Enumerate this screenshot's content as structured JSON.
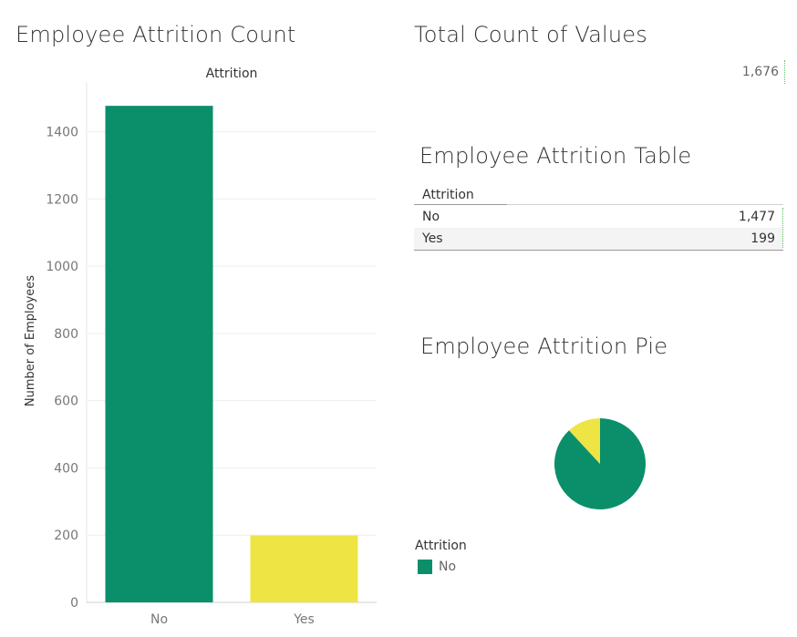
{
  "bar_title": "Employee Attrition Count",
  "total_title": "Total Count of Values",
  "total_value": "1,676",
  "table_title": "Employee Attrition Table",
  "pie_title": "Employee Attrition Pie",
  "table": {
    "header": "Attrition",
    "rows": [
      {
        "label": "No",
        "value": "1,477"
      },
      {
        "label": "Yes",
        "value": "199"
      }
    ]
  },
  "legend": {
    "title": "Attrition",
    "items": [
      {
        "label": "No",
        "color": "#0a8f6a"
      }
    ]
  },
  "chart_data": [
    {
      "type": "bar",
      "title": "Employee Attrition Count",
      "column_header": "Attrition",
      "ylabel": "Number of Employees",
      "categories": [
        "No",
        "Yes"
      ],
      "values": [
        1477,
        199
      ],
      "colors": [
        "#0a8f6a",
        "#eee444"
      ],
      "ylim": [
        0,
        1500
      ],
      "yticks": [
        0,
        200,
        400,
        600,
        800,
        1000,
        1200,
        1400
      ],
      "grid": true
    },
    {
      "type": "pie",
      "title": "Employee Attrition Pie",
      "categories": [
        "No",
        "Yes"
      ],
      "values": [
        1477,
        199
      ],
      "colors": [
        "#0a8f6a",
        "#eee444"
      ]
    }
  ]
}
